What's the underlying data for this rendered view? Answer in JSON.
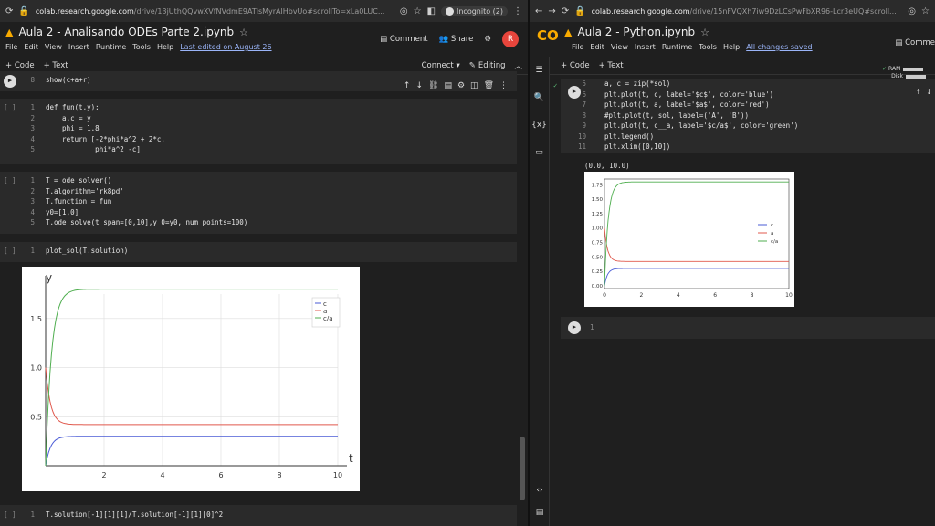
{
  "left": {
    "url_host": "colab.research.google.com",
    "url_path": "/drive/13jUthQQvwXVfNVdmE9ATlsMyrAlHbvUo#scrollTo=xLa0LUC...",
    "incognito": "Incognito (2)",
    "nb_title": "Aula 2 - Analisando ODEs Parte 2.ipynb",
    "menu": [
      "File",
      "Edit",
      "View",
      "Insert",
      "Runtime",
      "Tools",
      "Help"
    ],
    "last_edited": "Last edited on August 26",
    "comment": "Comment",
    "share": "Share",
    "avatar": "R",
    "code_btn": "+ Code",
    "text_btn": "+ Text",
    "connect": "Connect",
    "editing": "Editing",
    "cell0": {
      "n": "8",
      "code": "show(c+a+r)"
    },
    "cell1": {
      "bracket": "[ ]",
      "lines": [
        "1",
        "2",
        "3",
        "4",
        "5"
      ],
      "code": [
        "def fun(t,y):",
        "    a,c = y",
        "    phi = 1.8",
        "    return [-2*phi*a^2 + 2*c,",
        "            phi*a^2 -c]"
      ]
    },
    "cell2": {
      "bracket": "[ ]",
      "lines": [
        "1",
        "2",
        "3",
        "4",
        "5"
      ],
      "code": [
        "T = ode_solver()",
        "T.algorithm='rk8pd'",
        "T.function = fun",
        "y0=[1,0]",
        "T.ode_solve(t_span=[0,10],y_0=y0, num_points=100)"
      ]
    },
    "cell3": {
      "bracket": "[ ]",
      "lines": [
        "1"
      ],
      "code": [
        "plot_sol(T.solution)"
      ]
    },
    "cell4": {
      "bracket": "[ ]",
      "lines": [
        "1"
      ],
      "code": [
        "T.solution[-1][1][1]/T.solution[-1][1][0]^2"
      ]
    },
    "plot": {
      "ylabel": "y",
      "xlabel": "t",
      "yticks": [
        "0.5",
        "1.0",
        "1.5"
      ],
      "xticks": [
        "2",
        "4",
        "6",
        "8",
        "10"
      ],
      "legend": [
        "c",
        "a",
        "c/a"
      ],
      "colors": [
        "#4a5bd6",
        "#e0584c",
        "#4fae4f"
      ]
    }
  },
  "right": {
    "url_host": "colab.research.google.com",
    "url_path": "/drive/15nFVQXh7iw9DzLCsPwFbXR96-Lcr3eUQ#scroll...",
    "nb_title": "Aula 2 - Python.ipynb",
    "menu": [
      "File",
      "Edit",
      "View",
      "Insert",
      "Runtime",
      "Tools",
      "Help"
    ],
    "saved": "All changes saved",
    "comment": "Comme",
    "code_btn": "+ Code",
    "text_btn": "+ Text",
    "ram": "RAM",
    "disk": "Disk",
    "cell": {
      "lines": [
        "5",
        "6",
        "7",
        "8",
        "9",
        "10",
        "11"
      ],
      "code": [
        "a, c = zip(*sol)",
        "plt.plot(t, c, label='$c$', color='blue')",
        "plt.plot(t, a, label='$a$', color='red')",
        "#plt.plot(t, sol, label=('A', 'B'))",
        "plt.plot(t, c__a, label='$c/a$', color='green')",
        "plt.legend()",
        "plt.xlim([0,10])"
      ]
    },
    "output_text": "(0.0, 10.0)",
    "plot": {
      "yticks": [
        "0.00",
        "0.25",
        "0.50",
        "0.75",
        "1.00",
        "1.25",
        "1.50",
        "1.75"
      ],
      "xticks": [
        "0",
        "2",
        "4",
        "6",
        "8",
        "10"
      ],
      "legend": [
        "c",
        "a",
        "c/a"
      ]
    },
    "empty_cell_line": "1"
  }
}
